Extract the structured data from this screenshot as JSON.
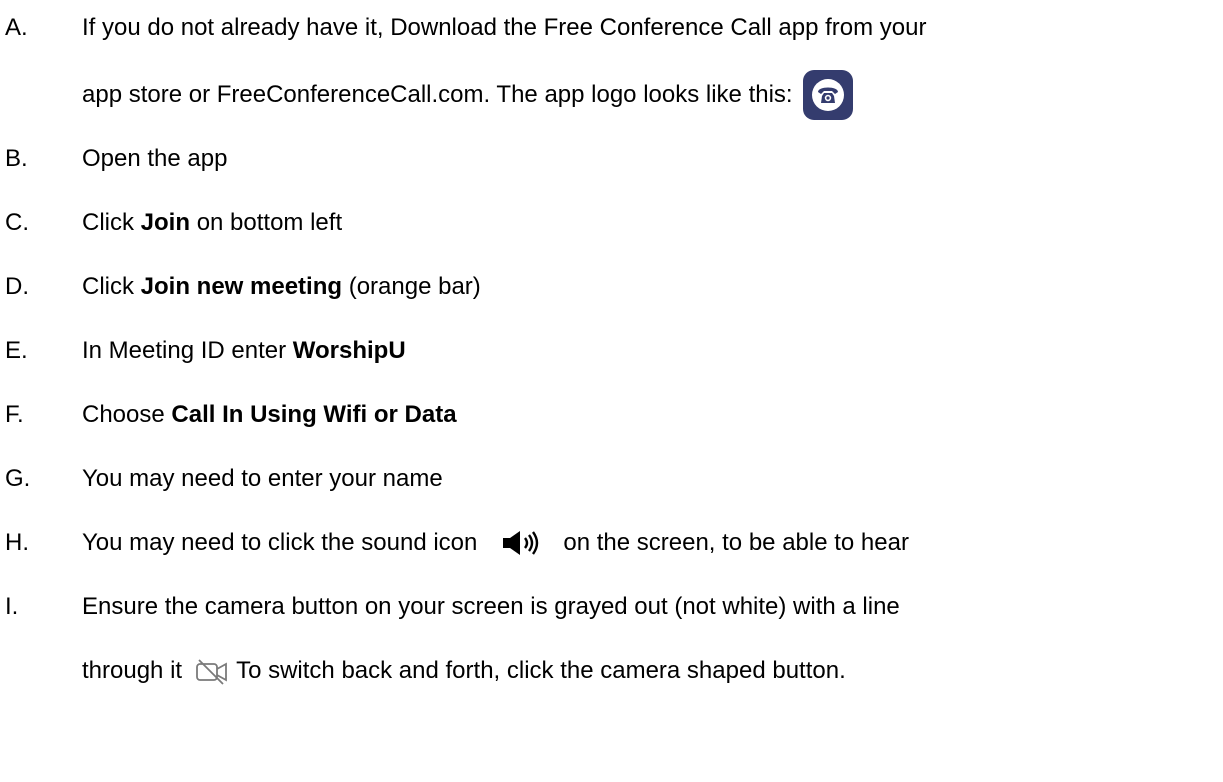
{
  "items": [
    {
      "letter": "A.",
      "line1": "If you do not already have it, Download the Free Conference Call app from your",
      "line2": "app store or FreeConferenceCall.com.  The app logo looks like this:",
      "logo_icon": "phone-app-logo-icon"
    },
    {
      "letter": "B.",
      "text": "Open the app"
    },
    {
      "letter": "C.",
      "pre": "Click",
      "bold": "Join",
      "post": "on bottom left"
    },
    {
      "letter": "D.",
      "pre": "Click",
      "bold": "Join new meeting",
      "post": "(orange bar)"
    },
    {
      "letter": "E.",
      "pre": "In Meeting ID enter",
      "bold": "WorshipU"
    },
    {
      "letter": "F.",
      "pre": "Choose",
      "bold": "Call In Using Wifi or Data"
    },
    {
      "letter": "G.",
      "text": "You may need to enter your name"
    },
    {
      "letter": "H.",
      "pre": "You may need to click the sound icon",
      "post": "on the screen, to be able to hear",
      "icon": "speaker-sound-icon"
    },
    {
      "letter": "I.",
      "line1": "Ensure the camera button on your screen is grayed out (not white) with a line",
      "line2_pre": "through it",
      "line2_post": "To switch back and forth, click the camera shaped button.",
      "icon": "camera-off-icon"
    }
  ],
  "colors": {
    "text": "#000000",
    "logo_bg": "#343c6e",
    "logo_fg": "#ffffff",
    "camera_icon": "#7a7a7a"
  }
}
